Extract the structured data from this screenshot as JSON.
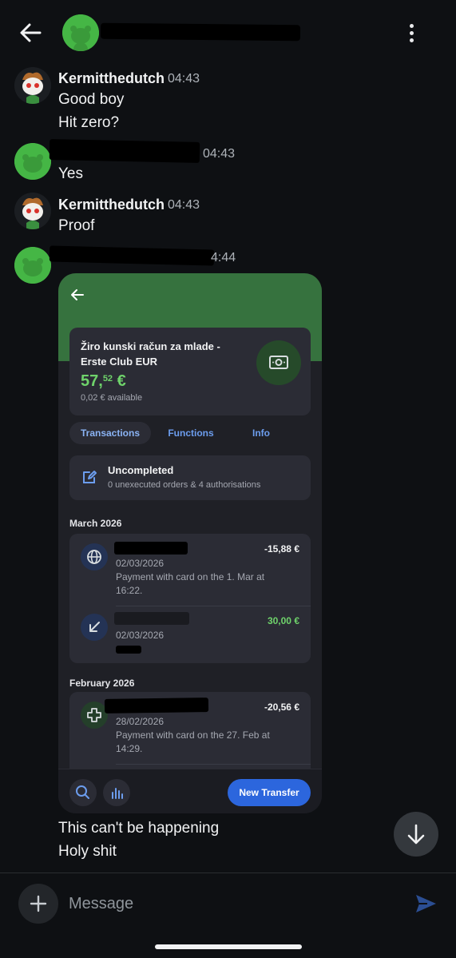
{
  "header": {
    "back_icon": "arrow-left-icon",
    "menu_icon": "more-vertical-icon"
  },
  "messages": [
    {
      "sender": "Kermitthedutch",
      "time": "04:43",
      "lines": [
        "Good boy",
        "Hit zero?"
      ]
    },
    {
      "sender": "",
      "time": "04:43",
      "lines": [
        "Yes"
      ]
    },
    {
      "sender": "Kermitthedutch",
      "time": "04:43",
      "lines": [
        "Proof"
      ]
    },
    {
      "sender": "",
      "time": "4:44",
      "lines": []
    }
  ],
  "screenshot": {
    "account_name": "Žiro kunski račun za mlade - Erste Club EUR",
    "balance_main": "57,",
    "balance_cents": "52",
    "balance_currency": "€",
    "available": "0,02 € available",
    "tabs": [
      "Transactions",
      "Functions",
      "Info"
    ],
    "uncompleted_title": "Uncompleted",
    "uncompleted_sub": "0 unexecuted orders & 4 authorisations",
    "months": [
      {
        "label": "March 2026",
        "transactions": [
          {
            "icon": "globe-icon",
            "amount": "-15,88 €",
            "date": "02/03/2026",
            "desc": "Payment with card on the 1. Mar at 16:22."
          },
          {
            "icon": "arrow-in-icon",
            "amount": "30,00 €",
            "date": "02/03/2026",
            "desc": ""
          }
        ]
      },
      {
        "label": "February 2026",
        "transactions": [
          {
            "icon": "pharmacy-cross-icon",
            "amount": "-20,56 €",
            "date": "28/02/2026",
            "desc": "Payment with card on the 27. Feb at 14:29."
          }
        ]
      }
    ],
    "new_transfer_label": "New Transfer"
  },
  "after_messages": [
    "This can't be happening",
    "Holy shit"
  ],
  "composer": {
    "placeholder": "Message"
  },
  "colors": {
    "background": "#0e1013",
    "accent_green": "#45b645",
    "bank_green": "#36723e",
    "primary_blue": "#2c66dd"
  }
}
